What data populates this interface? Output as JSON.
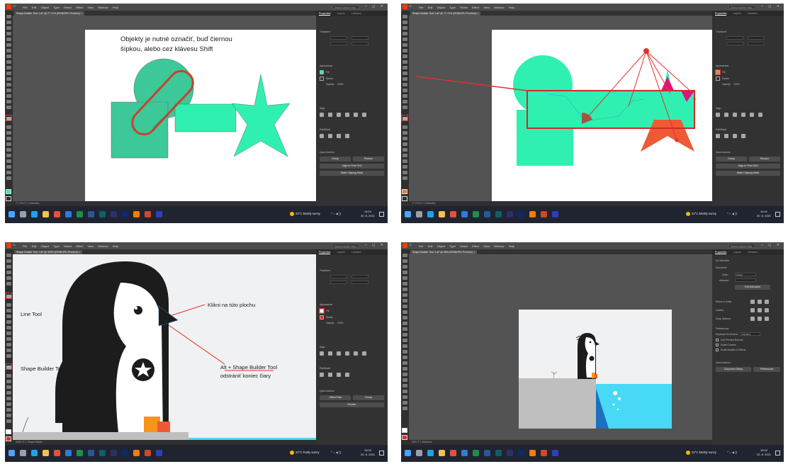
{
  "app": {
    "menus": [
      "File",
      "Edit",
      "Object",
      "Type",
      "Select",
      "Effect",
      "View",
      "Window",
      "Help"
    ],
    "search_placeholder": "Search Adobe Help",
    "window_controls": "– ◻ ✕"
  },
  "colors": {
    "accent_red": "#e0312b",
    "shape_green": "#2ff0b1",
    "pattern_green": "#28c28d",
    "outline_red": "#c8412f",
    "star_orange": "#ef5a35",
    "magenta": "#e0137c",
    "penguin_black": "#1c1c1c",
    "ice_blue": "#47d9f5",
    "water_blue": "#1f6fc0",
    "rock_grey": "#bfbfbf",
    "beak_orange": "#f7941d"
  },
  "panel": {
    "tabs": [
      "Properties",
      "Layers",
      "Libraries"
    ],
    "transform": "Transform",
    "appearance": "Appearance",
    "fill": "Fill",
    "stroke": "Stroke",
    "opacity": "Opacity",
    "opacity_value": "100%",
    "align": "Align",
    "pathfinder": "Pathfinder",
    "quick_actions": "Quick Actions",
    "group": "Group",
    "recolor": "Recolor",
    "align_to_pixel": "Align to Pixel Grid",
    "make_clipping": "Make Clipping Mask",
    "offset_path": "Offset Path",
    "no_selection": "No Selection",
    "document": "Document",
    "units_label": "Units:",
    "units_value": "Inches",
    "artboard_label": "Artboard:",
    "edit_artboards": "Edit Artboards",
    "ruler_grids": "Rulers & Grids",
    "guides": "Guides",
    "snap_options": "Snap Options",
    "preferences": "Preferences",
    "keyboard_increment": "Keyboard Increment:",
    "increment_value": "0.0139 in",
    "use_preview_bounds": "Use Preview Bounds",
    "scale_corners": "Scale Corners",
    "scale_strokes": "Scale Strokes & Effects",
    "document_setup": "Document Setup",
    "preferences_btn": "Preferences"
  },
  "taskbar": {
    "weather_sunny": "22°C  Mostly sunny",
    "weather_partly": "22°C  Partly sunny",
    "tray": "^ ⌂ ◀ ))",
    "clock_1": "14:24",
    "clock_2": "14:41",
    "clock_3": "15:02",
    "clock_4": "15:02",
    "date": "20. 8. 2021"
  },
  "panels": [
    {
      "doc_tab": "Shape Builder Tool 1.ai* @ 77.71% (RGB/GPU Preview)  ×",
      "status": "77.71%     0°     1          Selection",
      "annotation_line1": "Objekty je nutné označiť, buď čiernou",
      "annotation_line2": "šípkou, alebo cez klávesu Shift"
    },
    {
      "doc_tab": "Shape Builder Tool 1.ai* @ 77.71% (RGB/GPU Preview)  ×",
      "status": "77.71%     0°     1          Selection"
    },
    {
      "doc_tab": "Shape Builder Tool 1.ai* @ 300% (RGB/GPU Preview)  ×",
      "status": "300%     0°     1          Shape Builder",
      "label_line_tool": "Line Tool",
      "label_shape_builder": "Shape Builder Tool",
      "label_click": "Klikni na túto plochu",
      "label_alt_line1": "Alt + Shape Builder Tool",
      "label_alt_line2": "odstrániť koniec čiary"
    },
    {
      "doc_tab": "Shape Builder Tool 1.ai* @ 50% (RGB/GPU Preview)  ×",
      "status": "50%     0°     1          Selection"
    }
  ]
}
